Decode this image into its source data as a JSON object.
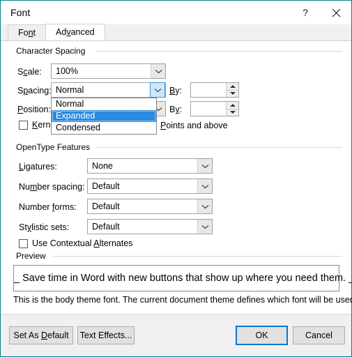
{
  "window": {
    "title": "Font",
    "help_icon": "question-mark-icon",
    "help_label": "?",
    "close_icon": "close-icon"
  },
  "tabs": [
    {
      "label": "Font",
      "active": false
    },
    {
      "label": "Advanced",
      "active": true
    }
  ],
  "character_spacing": {
    "group_label": "Character Spacing",
    "scale": {
      "label": "Scale:",
      "value": "100%"
    },
    "spacing": {
      "label": "Spacing:",
      "value": "Normal",
      "by_label": "By:",
      "by_value": "",
      "dropdown_open": true,
      "options": [
        "Normal",
        "Expanded",
        "Condensed"
      ],
      "selected_option": "Expanded"
    },
    "position": {
      "label": "Position:",
      "value": "",
      "by_label": "By:",
      "by_value": ""
    },
    "kerning": {
      "label": "Kerning for fonts:",
      "checked": false,
      "value": "",
      "suffix": "Points and above"
    }
  },
  "opentype": {
    "group_label": "OpenType Features",
    "rows": [
      {
        "label": "Ligatures:",
        "value": "None"
      },
      {
        "label": "Number spacing:",
        "value": "Default"
      },
      {
        "label": "Number forms:",
        "value": "Default"
      },
      {
        "label": "Stylistic sets:",
        "value": "Default"
      }
    ],
    "contextual_alternates": {
      "label": "Use Contextual Alternates",
      "checked": false
    }
  },
  "preview": {
    "group_label": "Preview",
    "sample_text": "_ Save time in Word with new buttons that show up where you need them. _",
    "note": "This is the body theme font. The current document theme defines which font will be used."
  },
  "footer": {
    "set_as_default": "Set As Default",
    "text_effects": "Text Effects...",
    "ok": "OK",
    "cancel": "Cancel"
  },
  "colors": {
    "dialog_border": "#0b7e8c",
    "accent_selection": "#2a8ae0",
    "primary_button_border": "#0078d7",
    "footer_background": "#f0f0f0"
  }
}
